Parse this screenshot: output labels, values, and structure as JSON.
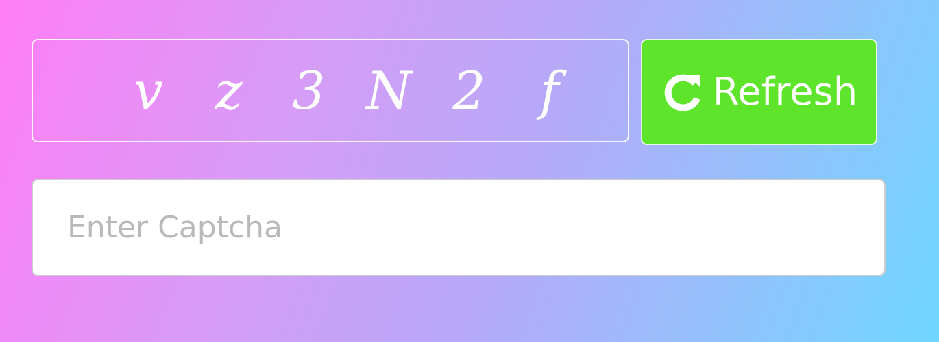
{
  "captcha": {
    "characters": [
      "v",
      "z",
      "3",
      "N",
      "2",
      "f"
    ]
  },
  "refresh_button": {
    "label": "Refresh",
    "icon": "refresh-icon",
    "background_color": "#5ee52b"
  },
  "captcha_input": {
    "value": "",
    "placeholder": "Enter Captcha"
  },
  "colors": {
    "gradient_start": "#ff7ef6",
    "gradient_end": "#6ed6fd"
  }
}
